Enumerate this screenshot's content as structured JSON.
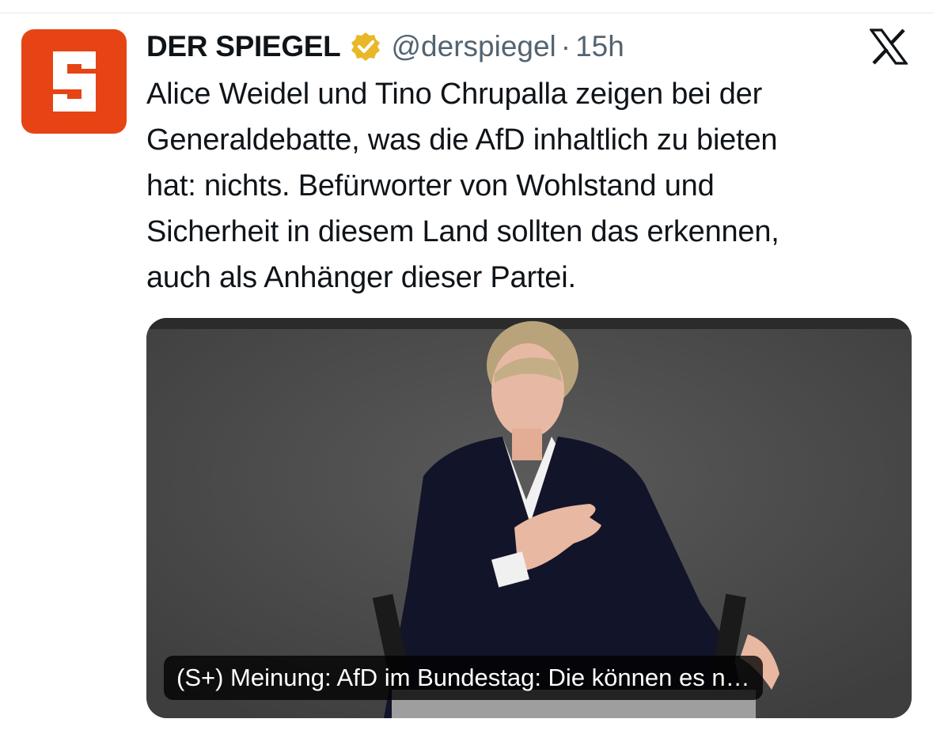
{
  "author": {
    "display_name": "DER SPIEGEL",
    "handle": "@derspiegel",
    "separator": "·",
    "time": "15h",
    "avatar_icon": "spiegel-s-logo",
    "avatar_color": "#e64415",
    "verified_icon": "verified-badge-gold",
    "verified_color": "#e8b829"
  },
  "platform_icon": "x-logo",
  "tweet": {
    "lines": [
      "Alice Weidel und Tino Chrupalla zeigen bei der",
      "Generaldebatte, was die AfD inhaltlich zu bieten",
      "hat: nichts. Befürworter von Wohlstand und",
      "Sicherheit in diesem Land sollten das erkennen,",
      "auch als Anhänger dieser Partei."
    ]
  },
  "link_card": {
    "caption": "(S+) Meinung: AfD im Bundestag: Die können es n…",
    "image": "speaker-at-podium-photo"
  },
  "colors": {
    "text_primary": "#0f1419",
    "text_secondary": "#536471"
  }
}
